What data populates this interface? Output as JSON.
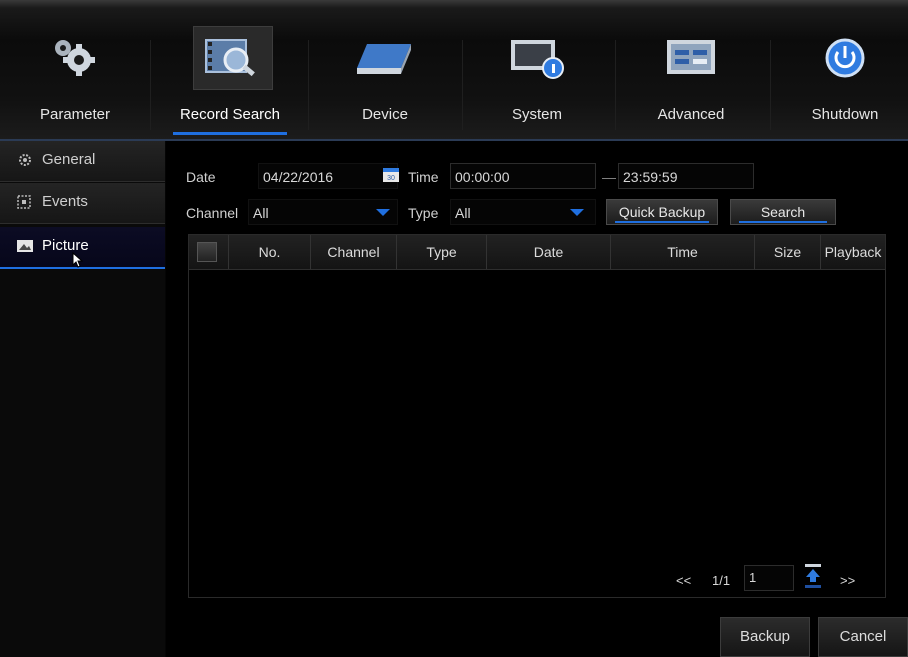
{
  "toolbar": {
    "tabs": [
      {
        "label": "Parameter",
        "icon": "gears-icon"
      },
      {
        "label": "Record Search",
        "icon": "film-magnifier-icon"
      },
      {
        "label": "Device",
        "icon": "hard-disk-icon"
      },
      {
        "label": "System",
        "icon": "monitor-info-icon"
      },
      {
        "label": "Advanced",
        "icon": "advanced-panel-icon"
      },
      {
        "label": "Shutdown",
        "icon": "power-icon"
      }
    ],
    "active_tab": "Record Search"
  },
  "sidebar": {
    "items": [
      {
        "label": "General",
        "icon": "gear-small-icon"
      },
      {
        "label": "Events",
        "icon": "events-icon"
      },
      {
        "label": "Picture",
        "icon": "picture-icon"
      }
    ],
    "active_item": "Picture"
  },
  "search": {
    "date_label": "Date",
    "date_value": "04/22/2016",
    "calendar_badge": "30",
    "time_label": "Time",
    "time_start": "00:00:00",
    "time_dash": "—",
    "time_end": "23:59:59",
    "channel_label": "Channel",
    "channel_value": "All",
    "type_label": "Type",
    "type_value": "All",
    "quick_backup_label": "Quick Backup",
    "search_label": "Search"
  },
  "table": {
    "columns": [
      "No.",
      "Channel",
      "Type",
      "Date",
      "Time",
      "Size",
      "Playback"
    ],
    "rows": []
  },
  "pagination": {
    "prev": "<<",
    "page_info": "1/1",
    "page_input": "1",
    "next": ">>"
  },
  "footer": {
    "backup_label": "Backup",
    "cancel_label": "Cancel"
  },
  "colors": {
    "accent": "#1f6fe0",
    "background": "#000000",
    "active_sidebar_text": "#ffffff"
  }
}
